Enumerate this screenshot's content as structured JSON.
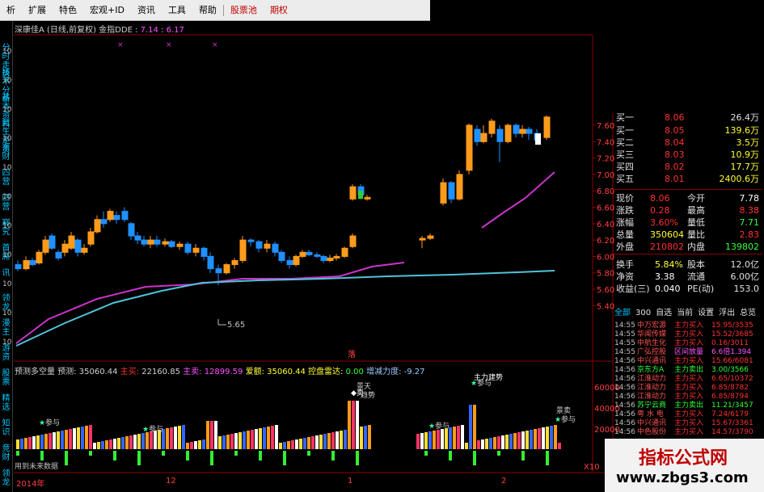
{
  "menu": {
    "items": [
      "析",
      "扩展",
      "特色",
      "宏观+ID",
      "资讯",
      "工具",
      "帮助",
      "股票池",
      "期权"
    ],
    "red_items": [
      "股票池",
      "期权"
    ]
  },
  "left_tabs": [
    "分时走势",
    "技术分析",
    "基本资料",
    "竞生走资",
    "东财",
    "四营",
    "四营",
    "巅究",
    "首席",
    "讯",
    "领龙",
    "漫主",
    "游资",
    "股票",
    "精选",
    "知识",
    "竞财",
    "领龙"
  ],
  "chart_header": {
    "stock_line": "深康佳A (日线,前复权) 金指DDE :",
    "val1": "7.14",
    "val2": "6.17"
  },
  "vol_header": {
    "prefix": "预测多空量 预测:",
    "predict": "35060.44",
    "buy_label": "主买:",
    "buy": "22160.85",
    "sell_label": "主卖:",
    "sell": "12899.59",
    "total_label": "爱额:",
    "total": "35060.44",
    "radar_label": "控盘雷达:",
    "radar": "0.00",
    "inc_label": "增减力度:",
    "inc": "-9.27"
  },
  "price_axis": [
    "7.60",
    "7.40",
    "7.20",
    "7.00",
    "6.80",
    "6.60",
    "6.40",
    "6.20",
    "6.00",
    "5.80",
    "5.60",
    "5.40"
  ],
  "left_axis_labels": [
    "10",
    "10",
    "10",
    "10",
    "10",
    "10",
    "10",
    "10",
    "10",
    "10",
    "10"
  ],
  "vol_axis": [
    "60000",
    "40000",
    "20000",
    "X10"
  ],
  "annotations": {
    "low_price": "5.65",
    "fall_marker": "落",
    "signal_canyu": "参与",
    "signal_qimai": "景天",
    "signal_zhushi": "主力建势",
    "signal_huimai": "◆卖",
    "signal_qushi": "趋势",
    "signal_jingmai": "景卖"
  },
  "vol_note": "用到未来数据",
  "dates": {
    "start": "2014年",
    "mid": "12",
    "m1": "1",
    "m2": "2"
  },
  "order_book": [
    {
      "label": "买一",
      "price": "8.05",
      "vol": "139.6万"
    },
    {
      "label": "买二",
      "price": "8.04",
      "vol": "3.5万"
    },
    {
      "label": "买三",
      "price": "8.03",
      "vol": "10.9万"
    },
    {
      "label": "买四",
      "price": "8.02",
      "vol": "17.7万"
    },
    {
      "label": "买五",
      "price": "8.01",
      "vol": "2400.6万"
    }
  ],
  "top_cut": {
    "label": "买一",
    "price": "8.06",
    "vol": "26.4万"
  },
  "stats": [
    {
      "l1": "现价",
      "v1": "8.06",
      "l2": "今开",
      "v2": "7.78"
    },
    {
      "l1": "涨跌",
      "v1": "0.28",
      "l2": "最高",
      "v2": "8.38"
    },
    {
      "l1": "涨幅",
      "v1": "3.60%",
      "l2": "量低",
      "v2": "7.71"
    },
    {
      "l1": "总量",
      "v1": "350604",
      "l2": "量比",
      "v2": "2.83"
    },
    {
      "l1": "外盘",
      "v1": "210802",
      "l2": "内盘",
      "v2": "139802"
    }
  ],
  "stats2": [
    {
      "l1": "换手",
      "v1": "5.84%",
      "l2": "股本",
      "v2": "12.0亿"
    },
    {
      "l1": "净资",
      "v1": "3.38",
      "l2": "流通",
      "v2": "6.00亿"
    },
    {
      "l1": "收益(三)",
      "v1": "0.040",
      "l2": "PE(动)",
      "v2": "153.0"
    }
  ],
  "panel_tabs": [
    "全部",
    "300",
    "自选",
    "当前",
    "设置",
    "浮出",
    "总览"
  ],
  "tick_rows": [
    {
      "t": "14:55",
      "name": "中万宏源",
      "type": "主力买入",
      "val": "15.95/3535"
    },
    {
      "t": "14:55",
      "name": "华闻传媒",
      "type": "主力买入",
      "val": "15.52/3685"
    },
    {
      "t": "14:55",
      "name": "中航生化",
      "type": "主力买入",
      "val": "0.16/3011"
    },
    {
      "t": "14:55",
      "name": "广弘控股",
      "type": "区间放量",
      "val": "6.6倍1.394"
    },
    {
      "t": "14:56",
      "name": "中兴通讯",
      "type": "主力买入",
      "val": "15.66/6081"
    },
    {
      "t": "14:56",
      "name": "京东方A",
      "type": "主力卖出",
      "val": "3.00/3566"
    },
    {
      "t": "14:56",
      "name": "江淮动力",
      "type": "主力买入",
      "val": "6.65/10372"
    },
    {
      "t": "14:56",
      "name": "江淮动力",
      "type": "主力买入",
      "val": "6.85/8782"
    },
    {
      "t": "14:56",
      "name": "江淮动力",
      "type": "主力买入",
      "val": "6.85/8794"
    },
    {
      "t": "14:56",
      "name": "苏宁云商",
      "type": "主力卖出",
      "val": "11.21/3457"
    },
    {
      "t": "14:56",
      "name": "粤 水 电",
      "type": "主力买入",
      "val": "7.24/6179"
    },
    {
      "t": "14:56",
      "name": "中兴通讯",
      "type": "主力买入",
      "val": "15.67/3361"
    },
    {
      "t": "14:56",
      "name": "中色股份",
      "type": "主力买入",
      "val": "14.57/3790"
    }
  ],
  "watermark": {
    "title": "指标公式网",
    "url": "www.zbgs3.com"
  },
  "colors": {
    "up": "#ff9b1a",
    "down": "#1e90ff",
    "ma_short": "#cc33cc",
    "ma_long": "#4fc3d8",
    "grid_red": "#8a0000"
  }
}
